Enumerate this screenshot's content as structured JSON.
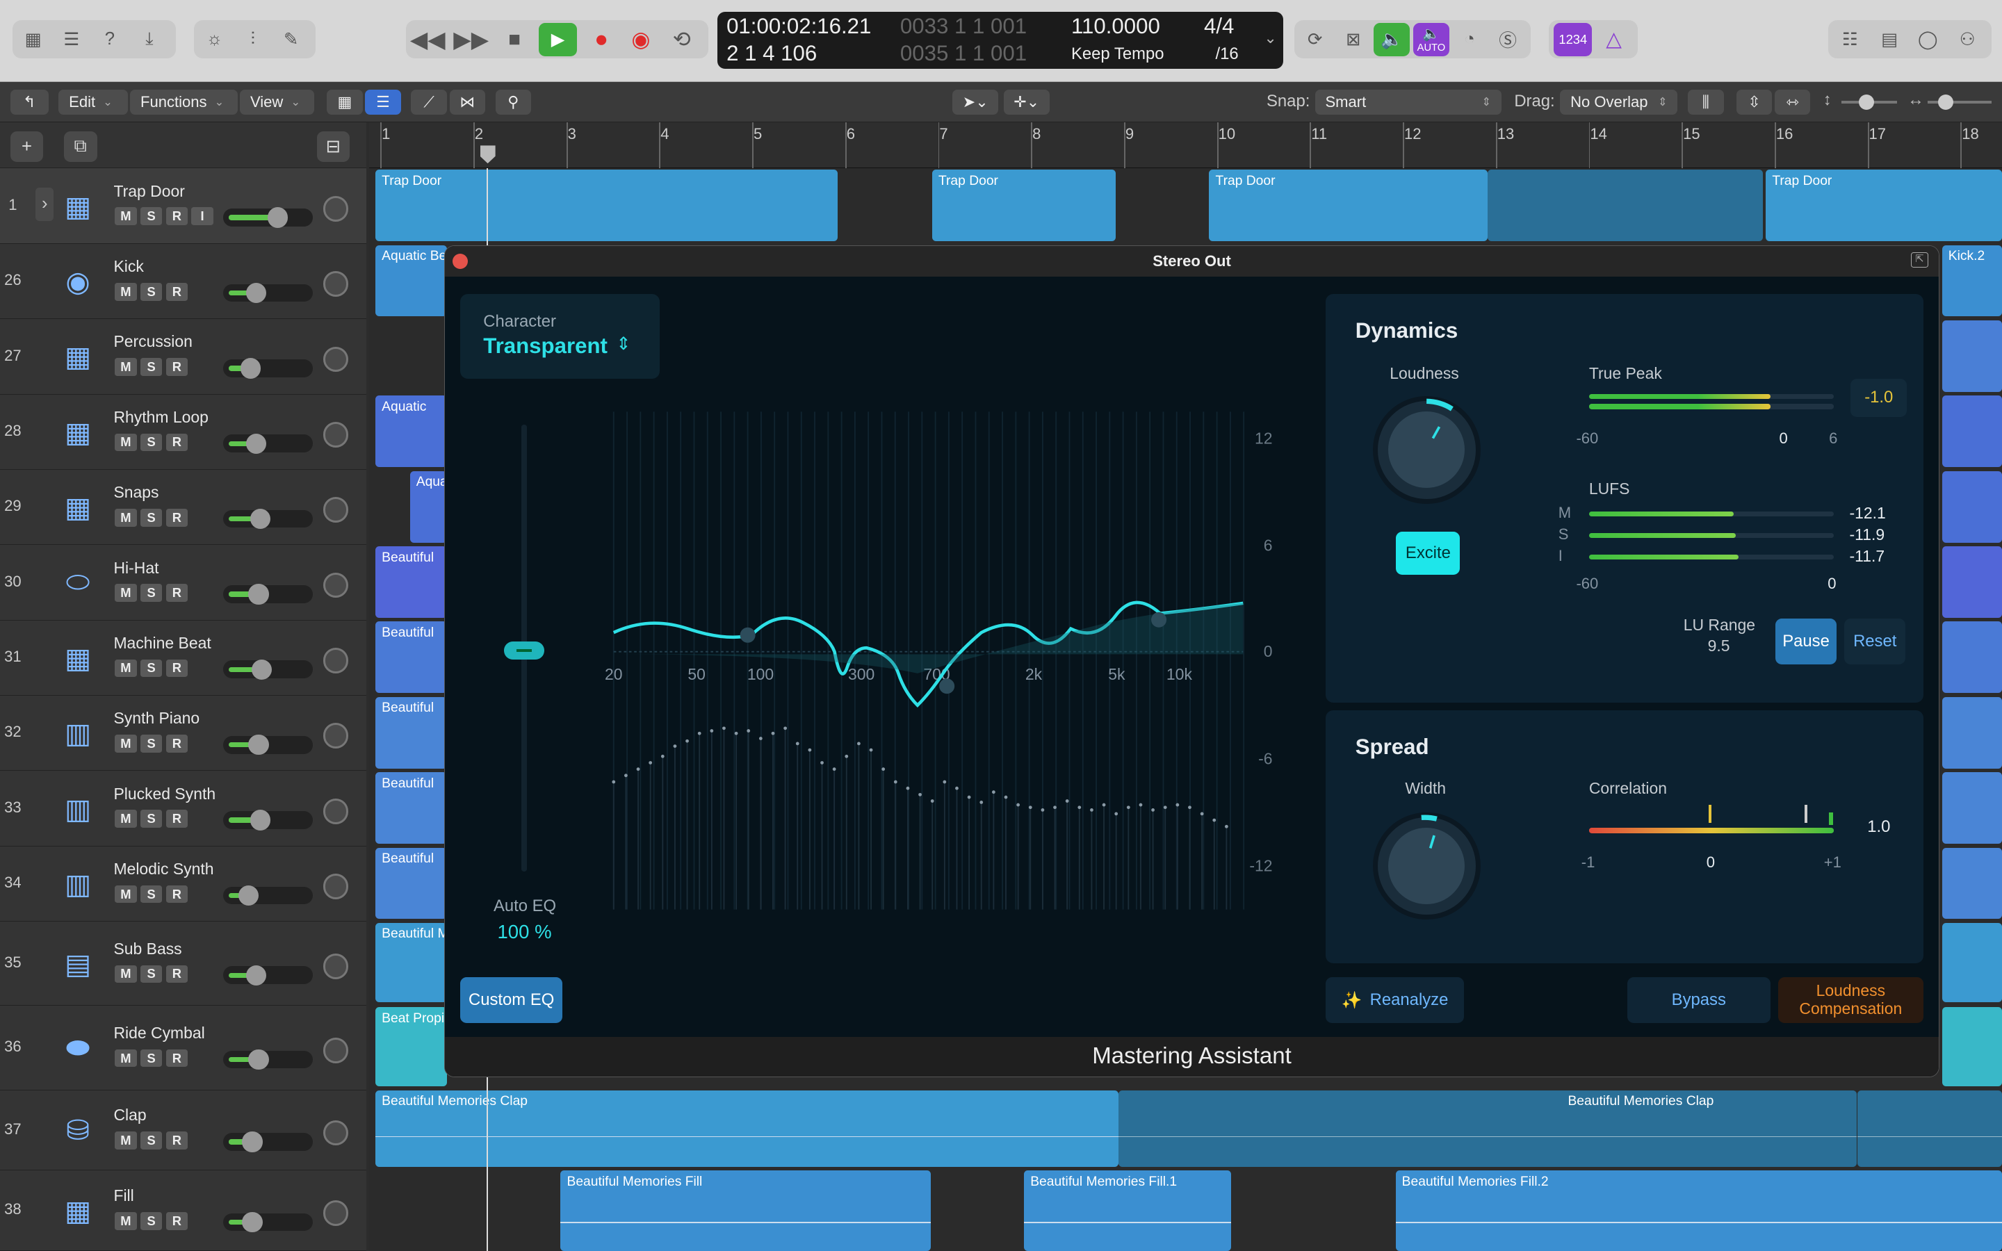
{
  "lcd": {
    "time": "01:00:02:16.21",
    "bars_pos": "2  1  4  106",
    "dim1": "0033  1  1  001",
    "dim2": "0035  1  1  001",
    "tempo": "110.0000",
    "tempo_mode": "Keep Tempo",
    "sig": "4/4",
    "div": "/16"
  },
  "control_bar": {
    "auto_label": "AUTO",
    "count_label": "1234"
  },
  "toolbar": {
    "edit": "Edit",
    "functions": "Functions",
    "view": "View",
    "snap_label": "Snap:",
    "snap_value": "Smart",
    "drag_label": "Drag:",
    "drag_value": "No Overlap"
  },
  "ruler": [
    "1",
    "2",
    "3",
    "4",
    "5",
    "6",
    "7",
    "8",
    "9",
    "10",
    "11",
    "12",
    "13",
    "14",
    "15",
    "16",
    "17",
    "18"
  ],
  "tracks": [
    {
      "num": "1",
      "name": "Trap Door",
      "icon": "drum-machine-icon",
      "vol": 0.62
    },
    {
      "num": "26",
      "name": "Kick",
      "icon": "kick-drum-icon",
      "vol": 0.35
    },
    {
      "num": "27",
      "name": "Percussion",
      "icon": "drum-machine-icon",
      "vol": 0.28
    },
    {
      "num": "28",
      "name": "Rhythm Loop",
      "icon": "drum-machine-icon",
      "vol": 0.35
    },
    {
      "num": "29",
      "name": "Snaps",
      "icon": "drum-machine-icon",
      "vol": 0.4
    },
    {
      "num": "30",
      "name": "Hi-Hat",
      "icon": "hihat-icon",
      "vol": 0.38
    },
    {
      "num": "31",
      "name": "Machine Beat",
      "icon": "drum-machine-icon",
      "vol": 0.42
    },
    {
      "num": "32",
      "name": "Synth Piano",
      "icon": "keyboard-icon",
      "vol": 0.38
    },
    {
      "num": "33",
      "name": "Plucked Synth",
      "icon": "keyboard-icon",
      "vol": 0.4
    },
    {
      "num": "34",
      "name": "Melodic Synth",
      "icon": "keyboard-icon",
      "vol": 0.25
    },
    {
      "num": "35",
      "name": "Sub Bass",
      "icon": "synth-icon",
      "vol": 0.35
    },
    {
      "num": "36",
      "name": "Ride Cymbal",
      "icon": "cymbal-icon",
      "vol": 0.38
    },
    {
      "num": "37",
      "name": "Clap",
      "icon": "snare-icon",
      "vol": 0.3
    },
    {
      "num": "38",
      "name": "Fill",
      "icon": "drum-machine-icon",
      "vol": 0.3
    }
  ],
  "track_buttons": {
    "m": "M",
    "s": "S",
    "r": "R",
    "i": "I"
  },
  "regions": {
    "trap": "Trap Door",
    "aquatic_be": "Aquatic Be",
    "aquatic": "Aquatic",
    "aqua": "Aqua",
    "beautiful": "Beautiful",
    "beautiful_m": "Beautiful M",
    "beat_prop": "Beat Propi",
    "kick2": "Kick.2",
    "clap1": "Beautiful Memories Clap",
    "clap2": "Beautiful Memories Clap",
    "fill1": "Beautiful Memories Fill",
    "fill2": "Beautiful Memories Fill.1",
    "fill3": "Beautiful Memories Fill.2"
  },
  "plugin": {
    "window_title": "Stereo Out",
    "footer": "Mastering Assistant",
    "character_label": "Character",
    "character_value": "Transparent",
    "eq_freqs": [
      "20",
      "50",
      "100",
      "300",
      "700",
      "2k",
      "5k",
      "10k"
    ],
    "eq_db": [
      "12",
      "6",
      "0",
      "-6",
      "-12"
    ],
    "auto_eq_label": "Auto EQ",
    "auto_eq_value": "100 %",
    "custom_eq": "Custom EQ",
    "dynamics": "Dynamics",
    "loudness": "Loudness",
    "excite": "Excite",
    "true_peak": "True Peak",
    "true_peak_value": "-1.0",
    "tp_scale": [
      "-60",
      "0",
      "6"
    ],
    "lufs": "LUFS",
    "lufs_rows": [
      {
        "k": "M",
        "v": "-12.1",
        "fill": 0.59
      },
      {
        "k": "S",
        "v": "-11.9",
        "fill": 0.6
      },
      {
        "k": "I",
        "v": "-11.7",
        "fill": 0.61
      }
    ],
    "lufs_scale": [
      "-60",
      "0"
    ],
    "lu_range_label": "LU Range",
    "lu_range_value": "9.5",
    "pause": "Pause",
    "reset": "Reset",
    "spread": "Spread",
    "width": "Width",
    "correlation": "Correlation",
    "corr_value": "1.0",
    "corr_scale": [
      "-1",
      "0",
      "+1"
    ],
    "reanalyze": "Reanalyze",
    "bypass": "Bypass",
    "loudness_comp": "Loudness Compensation"
  }
}
